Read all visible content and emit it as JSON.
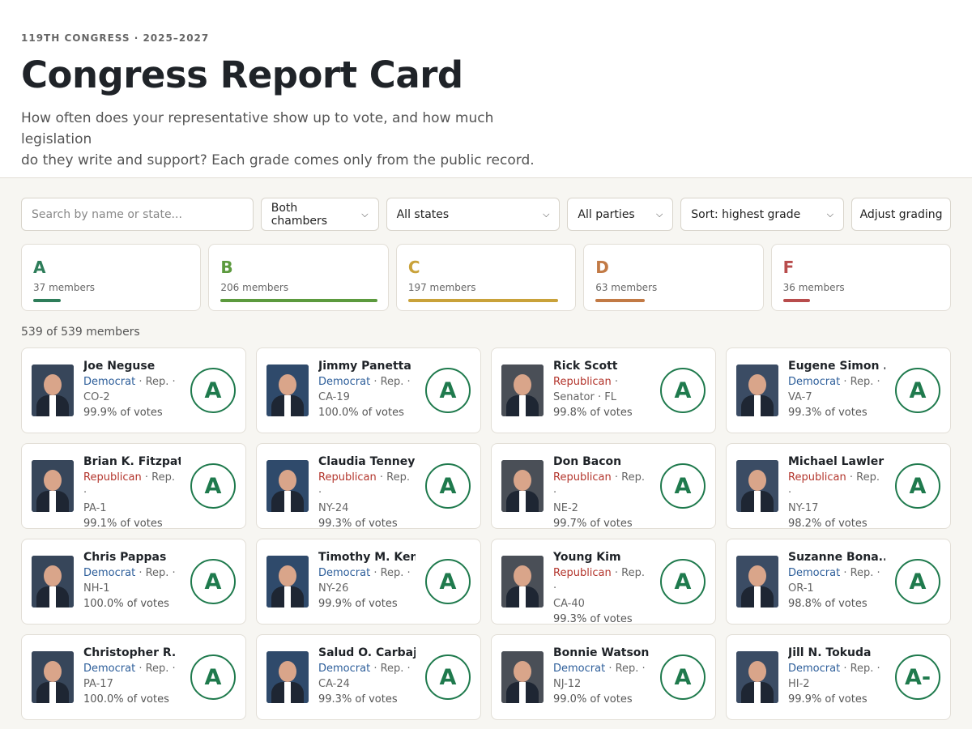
{
  "header": {
    "eyebrow": "119TH CONGRESS · 2025–2027",
    "title": "Congress Report Card",
    "subtitle_line1": "How often does your representative show up to vote, and how much legislation",
    "subtitle_line2": "do they write and support? Each grade comes only from the public record."
  },
  "controls": {
    "search_placeholder": "Search by name or state...",
    "chamber": "Both chambers",
    "states": "All states",
    "parties": "All parties",
    "sort": "Sort: highest grade",
    "adjust": "Adjust grading"
  },
  "grades": [
    {
      "letter": "A",
      "count": "37 members",
      "color": "#2e7d5a",
      "share": 0.16
    },
    {
      "letter": "B",
      "count": "206 members",
      "color": "#5c9a3e",
      "share": 0.92
    },
    {
      "letter": "C",
      "count": "197 members",
      "color": "#c9a23a",
      "share": 0.88
    },
    {
      "letter": "D",
      "count": "63 members",
      "color": "#c27a45",
      "share": 0.29
    },
    {
      "letter": "F",
      "count": "36 members",
      "color": "#b84c4c",
      "share": 0.16
    }
  ],
  "count_line": "539 of 539 members",
  "members": [
    {
      "name": "Joe Neguse",
      "party": "Democrat",
      "line1_rest": " · Rep. ·",
      "line2": "CO-2",
      "votes": "99.9% of votes",
      "grade": "A"
    },
    {
      "name": "Jimmy Panetta",
      "party": "Democrat",
      "line1_rest": " · Rep. ·",
      "line2": "CA-19",
      "votes": "100.0% of votes",
      "grade": "A"
    },
    {
      "name": "Rick Scott",
      "party": "Republican",
      "line1_rest": " ·",
      "line2": "Senator · FL",
      "votes": "99.8% of votes",
      "grade": "A"
    },
    {
      "name": "Eugene Simon ...",
      "party": "Democrat",
      "line1_rest": " · Rep. ·",
      "line2": "VA-7",
      "votes": "99.3% of votes",
      "grade": "A"
    },
    {
      "name": "Brian K. Fitzpat...",
      "party": "Republican",
      "line1_rest": " · Rep. ·",
      "line2": "PA-1",
      "votes": "99.1% of votes",
      "grade": "A"
    },
    {
      "name": "Claudia Tenney",
      "party": "Republican",
      "line1_rest": " · Rep. ·",
      "line2": "NY-24",
      "votes": "99.3% of votes",
      "grade": "A"
    },
    {
      "name": "Don Bacon",
      "party": "Republican",
      "line1_rest": " · Rep. ·",
      "line2": "NE-2",
      "votes": "99.7% of votes",
      "grade": "A"
    },
    {
      "name": "Michael Lawler",
      "party": "Republican",
      "line1_rest": " · Rep. ·",
      "line2": "NY-17",
      "votes": "98.2% of votes",
      "grade": "A"
    },
    {
      "name": "Chris Pappas",
      "party": "Democrat",
      "line1_rest": " · Rep. ·",
      "line2": "NH-1",
      "votes": "100.0% of votes",
      "grade": "A"
    },
    {
      "name": "Timothy M. Ken...",
      "party": "Democrat",
      "line1_rest": " · Rep. ·",
      "line2": "NY-26",
      "votes": "99.9% of votes",
      "grade": "A"
    },
    {
      "name": "Young Kim",
      "party": "Republican",
      "line1_rest": " · Rep. ·",
      "line2": "CA-40",
      "votes": "99.3% of votes",
      "grade": "A"
    },
    {
      "name": "Suzanne Bona...",
      "party": "Democrat",
      "line1_rest": " · Rep. ·",
      "line2": "OR-1",
      "votes": "98.8% of votes",
      "grade": "A"
    },
    {
      "name": "Christopher R. ...",
      "party": "Democrat",
      "line1_rest": " · Rep. ·",
      "line2": "PA-17",
      "votes": "100.0% of votes",
      "grade": "A"
    },
    {
      "name": "Salud O. Carbajal",
      "party": "Democrat",
      "line1_rest": " · Rep. ·",
      "line2": "CA-24",
      "votes": "99.3% of votes",
      "grade": "A"
    },
    {
      "name": "Bonnie Watson ...",
      "party": "Democrat",
      "line1_rest": " · Rep. ·",
      "line2": "NJ-12",
      "votes": "99.0% of votes",
      "grade": "A"
    },
    {
      "name": "Jill N. Tokuda",
      "party": "Democrat",
      "line1_rest": " · Rep. ·",
      "line2": "HI-2",
      "votes": "99.9% of votes",
      "grade": "A-"
    }
  ]
}
